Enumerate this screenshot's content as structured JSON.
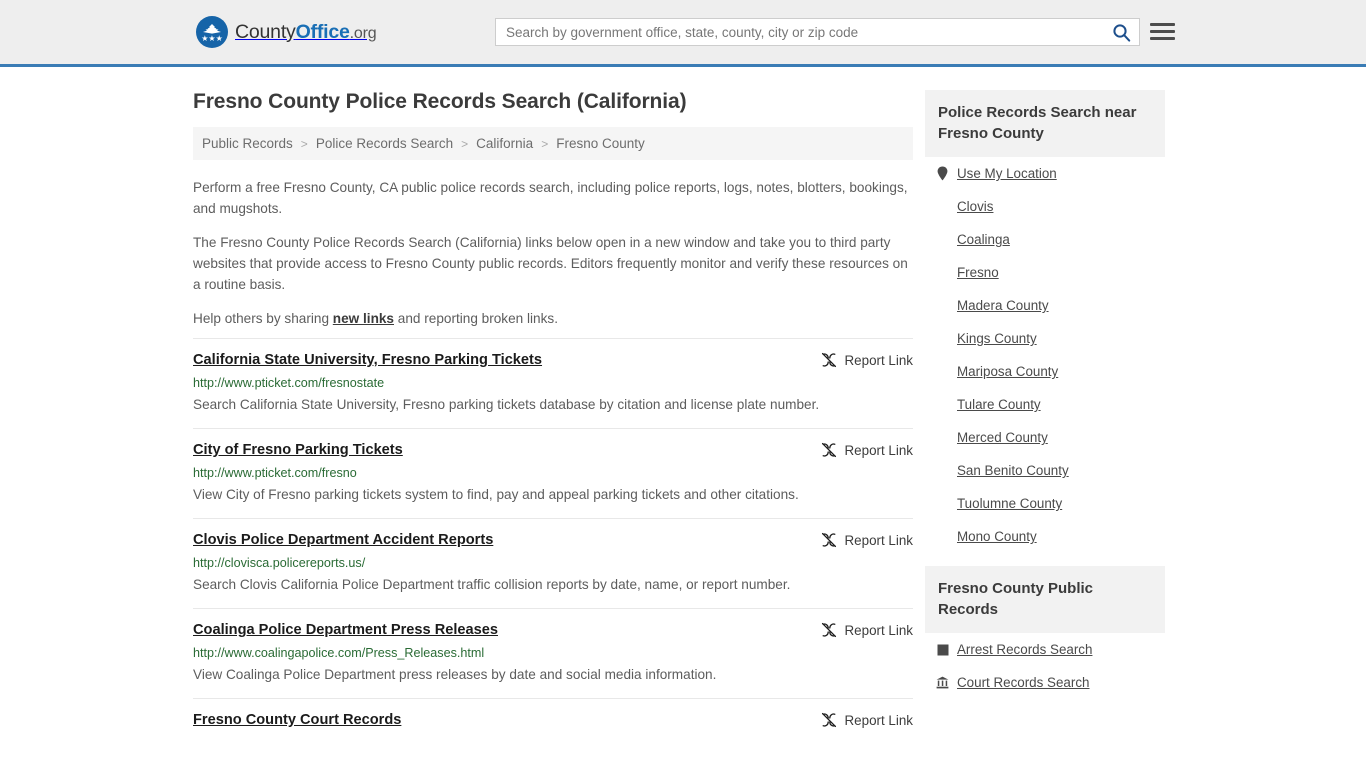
{
  "header": {
    "brand": {
      "part1": "County",
      "part2": "Office",
      "part3": ".org",
      "logo_icon": "eagle-seal-icon"
    },
    "search": {
      "placeholder": "Search by government office, state, county, city or zip code",
      "value": "",
      "search_icon": "search-icon"
    },
    "menu_icon": "hamburger-menu-icon",
    "accent_color": "#3a7cb5"
  },
  "main": {
    "page_title": "Fresno County Police Records Search (California)",
    "breadcrumb": {
      "separator": ">",
      "items": [
        {
          "label": "Public Records"
        },
        {
          "label": "Police Records Search"
        },
        {
          "label": "California"
        },
        {
          "label": "Fresno County"
        }
      ]
    },
    "intro": {
      "p1": "Perform a free Fresno County, CA public police records search, including police reports, logs, notes, blotters, bookings, and mugshots.",
      "p2": "The Fresno County Police Records Search (California) links below open in a new window and take you to third party websites that provide access to Fresno County public records. Editors frequently monitor and verify these resources on a routine basis.",
      "p3_before": "Help others by sharing ",
      "p3_link": "new links",
      "p3_after": " and reporting broken links."
    },
    "report_link_label": "Report Link",
    "report_link_icon": "broken-link-icon",
    "listings": [
      {
        "title": "California State University, Fresno Parking Tickets",
        "url": "http://www.pticket.com/fresnostate",
        "description": "Search California State University, Fresno parking tickets database by citation and license plate number."
      },
      {
        "title": "City of Fresno Parking Tickets",
        "url": "http://www.pticket.com/fresno",
        "description": "View City of Fresno parking tickets system to find, pay and appeal parking tickets and other citations."
      },
      {
        "title": "Clovis Police Department Accident Reports",
        "url": "http://clovisca.policereports.us/",
        "description": "Search Clovis California Police Department traffic collision reports by date, name, or report number."
      },
      {
        "title": "Coalinga Police Department Press Releases",
        "url": "http://www.coalingapolice.com/Press_Releases.html",
        "description": "View Coalinga Police Department press releases by date and social media information."
      },
      {
        "title": "Fresno County Court Records",
        "url": "",
        "description": ""
      }
    ]
  },
  "sidebar": {
    "nearby": {
      "title": "Police Records Search near Fresno County",
      "items": [
        {
          "label": "Use My Location",
          "icon": "map-pin-icon"
        },
        {
          "label": "Clovis",
          "icon": ""
        },
        {
          "label": "Coalinga",
          "icon": ""
        },
        {
          "label": "Fresno",
          "icon": ""
        },
        {
          "label": "Madera County",
          "icon": ""
        },
        {
          "label": "Kings County",
          "icon": ""
        },
        {
          "label": "Mariposa County",
          "icon": ""
        },
        {
          "label": "Tulare County",
          "icon": ""
        },
        {
          "label": "Merced County",
          "icon": ""
        },
        {
          "label": "San Benito County",
          "icon": ""
        },
        {
          "label": "Tuolumne County",
          "icon": ""
        },
        {
          "label": "Mono County",
          "icon": ""
        }
      ]
    },
    "public_records": {
      "title": "Fresno County Public Records",
      "items": [
        {
          "label": "Arrest Records Search",
          "icon": "square-badge-icon"
        },
        {
          "label": "Court Records Search",
          "icon": "courthouse-icon"
        }
      ]
    }
  }
}
